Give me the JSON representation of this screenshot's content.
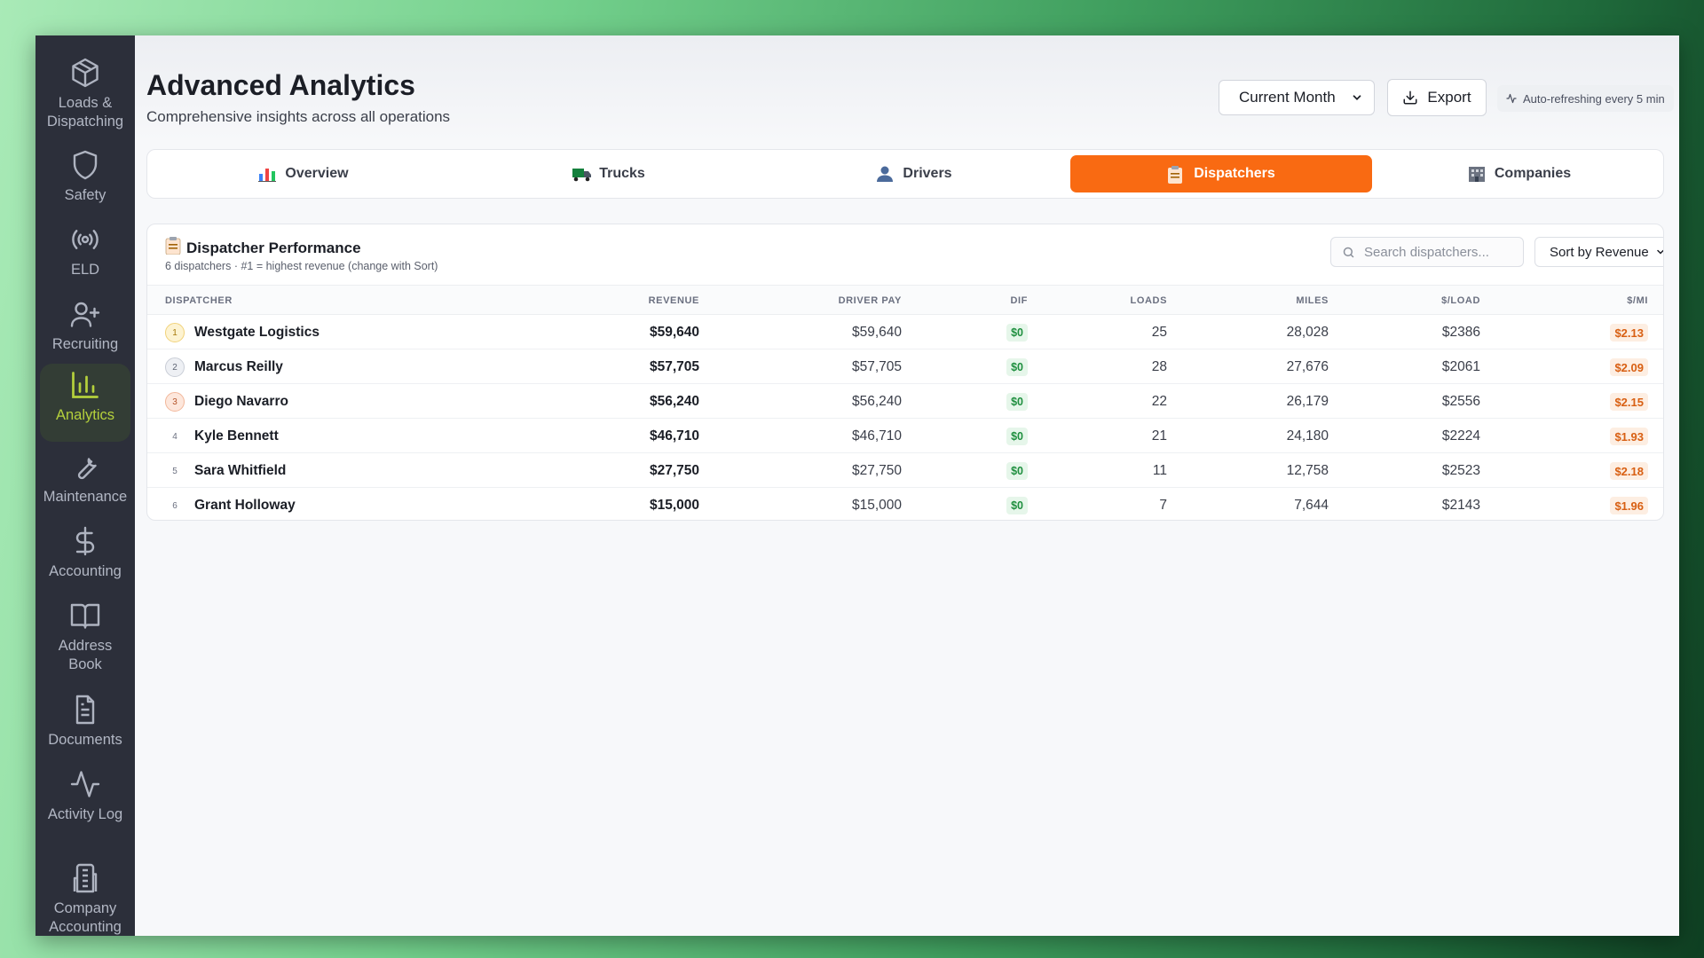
{
  "sidebar": {
    "items": [
      {
        "label": "Loads & Dispatching",
        "icon": "package-icon",
        "active": false
      },
      {
        "label": "Safety",
        "icon": "shield-icon",
        "active": false
      },
      {
        "label": "ELD",
        "icon": "broadcast-icon",
        "active": false
      },
      {
        "label": "Recruiting",
        "icon": "user-plus-icon",
        "active": false
      },
      {
        "label": "Analytics",
        "icon": "bar-chart-icon",
        "active": true
      },
      {
        "label": "Maintenance",
        "icon": "wrench-icon",
        "active": false
      },
      {
        "label": "Accounting",
        "icon": "dollar-icon",
        "active": false
      },
      {
        "label": "Address Book",
        "icon": "book-icon",
        "active": false
      },
      {
        "label": "Documents",
        "icon": "document-icon",
        "active": false
      },
      {
        "label": "Activity Log",
        "icon": "activity-icon",
        "active": false
      },
      {
        "label": "Company Accounting",
        "icon": "building-icon",
        "active": false
      }
    ]
  },
  "header": {
    "title": "Advanced Analytics",
    "subtitle": "Comprehensive insights across all operations",
    "period": "Current Month",
    "export_label": "Export",
    "auto_refresh": "Auto-refreshing every 5 min"
  },
  "tabs": [
    {
      "label": "Overview",
      "icon": "chart-icon",
      "active": false
    },
    {
      "label": "Trucks",
      "icon": "truck-icon",
      "active": false
    },
    {
      "label": "Drivers",
      "icon": "person-icon",
      "active": false
    },
    {
      "label": "Dispatchers",
      "icon": "clipboard-icon",
      "active": true
    },
    {
      "label": "Companies",
      "icon": "building-icon",
      "active": false
    }
  ],
  "panel": {
    "title": "Dispatcher Performance",
    "subtitle": "6 dispatchers · #1 = highest revenue (change with Sort)",
    "search_placeholder": "Search dispatchers...",
    "sort_label": "Sort by Revenue",
    "columns": {
      "dispatcher": "DISPATCHER",
      "revenue": "REVENUE",
      "driver_pay": "DRIVER PAY",
      "dif": "DIF",
      "loads": "LOADS",
      "miles": "MILES",
      "per_load": "$/LOAD",
      "per_mile": "$/MI"
    },
    "rows": [
      {
        "rank": "1",
        "name": "Westgate Logistics",
        "revenue": "$59,640",
        "driver_pay": "$59,640",
        "dif": "$0",
        "loads": "25",
        "miles": "28,028",
        "per_load": "$2386",
        "per_mile": "$2.13"
      },
      {
        "rank": "2",
        "name": "Marcus Reilly",
        "revenue": "$57,705",
        "driver_pay": "$57,705",
        "dif": "$0",
        "loads": "28",
        "miles": "27,676",
        "per_load": "$2061",
        "per_mile": "$2.09"
      },
      {
        "rank": "3",
        "name": "Diego Navarro",
        "revenue": "$56,240",
        "driver_pay": "$56,240",
        "dif": "$0",
        "loads": "22",
        "miles": "26,179",
        "per_load": "$2556",
        "per_mile": "$2.15"
      },
      {
        "rank": "4",
        "name": "Kyle Bennett",
        "revenue": "$46,710",
        "driver_pay": "$46,710",
        "dif": "$0",
        "loads": "21",
        "miles": "24,180",
        "per_load": "$2224",
        "per_mile": "$1.93"
      },
      {
        "rank": "5",
        "name": "Sara Whitfield",
        "revenue": "$27,750",
        "driver_pay": "$27,750",
        "dif": "$0",
        "loads": "11",
        "miles": "12,758",
        "per_load": "$2523",
        "per_mile": "$2.18"
      },
      {
        "rank": "6",
        "name": "Grant Holloway",
        "revenue": "$15,000",
        "driver_pay": "$15,000",
        "dif": "$0",
        "loads": "7",
        "miles": "7,644",
        "per_load": "$2143",
        "per_mile": "$1.96"
      }
    ]
  },
  "colors": {
    "accent": "#f96a12",
    "sidebar_bg": "#2c2f3a",
    "active_nav": "#b5d13c",
    "positive": "#1f8f3f"
  }
}
